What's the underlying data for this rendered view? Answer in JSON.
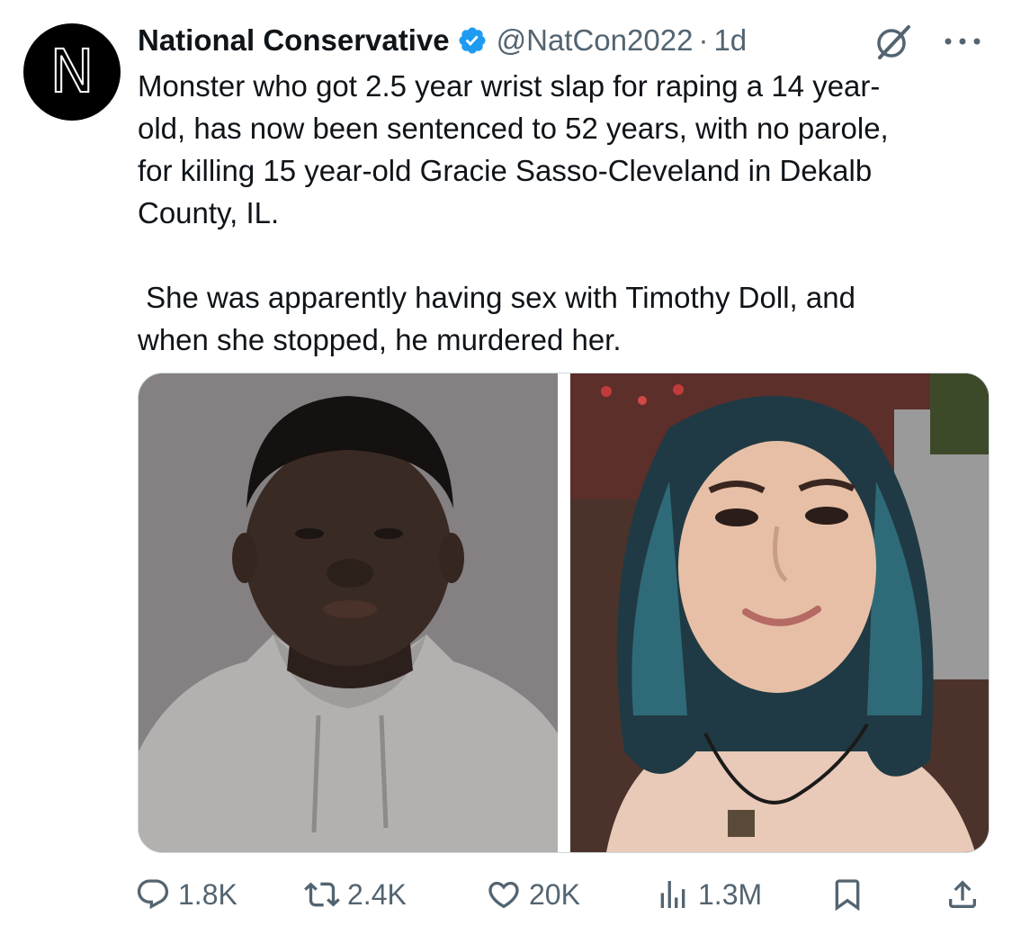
{
  "tweet": {
    "avatar_letter": "N",
    "display_name": "National Conservative",
    "handle": "@NatCon2022",
    "separator": "·",
    "time": "1d",
    "text": "Monster who got 2.5 year wrist slap for raping a 14 year-\nold, has now been sentenced to 52 years, with no parole,\nfor killing 15 year-old Gracie Sasso-Cleveland in Dekalb\nCounty, IL.\n\n She was apparently having sex with Timothy Doll, and\nwhen she stopped, he murdered her."
  },
  "actions": {
    "replies": "1.8K",
    "reposts": "2.4K",
    "likes": "20K",
    "views": "1.3M"
  },
  "icons": {
    "verified": "verified-badge-icon",
    "grok": "grok-icon",
    "more": "more-icon",
    "reply": "reply-icon",
    "repost": "repost-icon",
    "like": "like-icon",
    "views": "views-icon",
    "bookmark": "bookmark-icon",
    "share": "share-icon"
  },
  "colors": {
    "text": "#0f1419",
    "muted": "#536471",
    "verified": "#1d9bf0"
  }
}
